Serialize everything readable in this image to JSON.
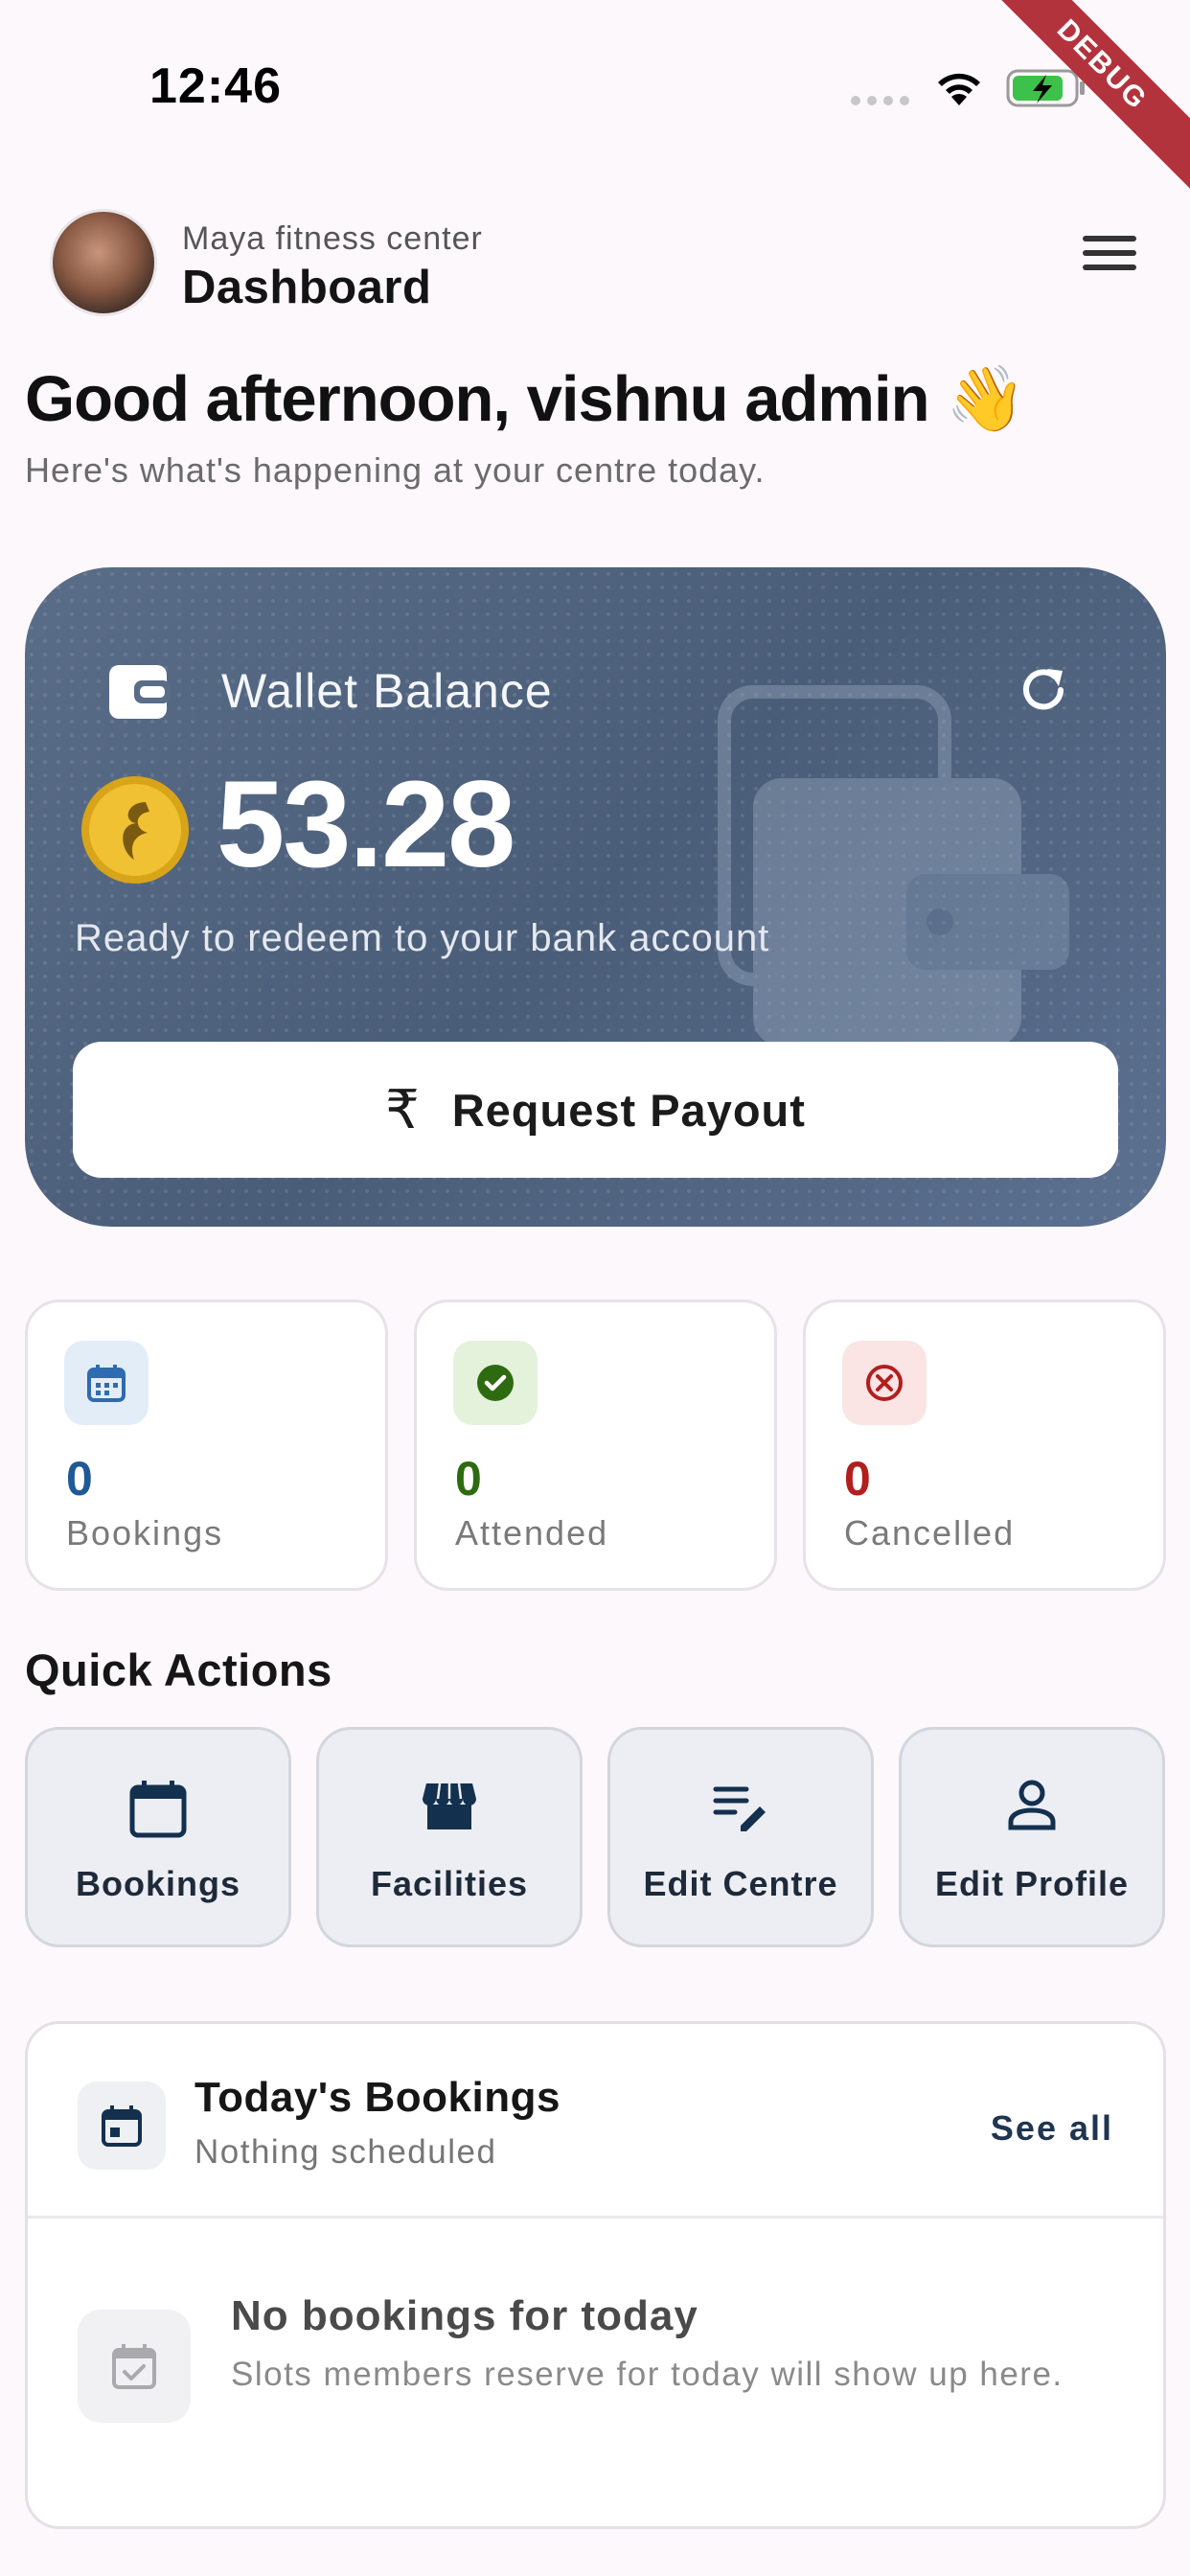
{
  "status_bar": {
    "time": "12:46",
    "debug_label": "DEBUG"
  },
  "header": {
    "centre_name": "Maya fitness center",
    "title": "Dashboard"
  },
  "greeting": {
    "title": "Good afternoon, vishnu admin 👋",
    "subtitle": "Here's what's happening at your centre today."
  },
  "wallet": {
    "label": "Wallet Balance",
    "amount": "53.28",
    "subtitle": "Ready to redeem to your bank account",
    "button_icon": "₹",
    "button_label": "Request Payout"
  },
  "stats": [
    {
      "value": "0",
      "label": "Bookings",
      "color": "#1f5a96",
      "icon_bg": "#e3edf8",
      "icon": "calendar-icon"
    },
    {
      "value": "0",
      "label": "Attended",
      "color": "#2e6b10",
      "icon_bg": "#e4f2dc",
      "icon": "check-circle-icon"
    },
    {
      "value": "0",
      "label": "Cancelled",
      "color": "#b21e1e",
      "icon_bg": "#fbe4e4",
      "icon": "cancel-circle-icon"
    }
  ],
  "quick_actions": {
    "title": "Quick Actions",
    "items": [
      {
        "label": "Bookings",
        "icon": "calendar-icon"
      },
      {
        "label": "Facilities",
        "icon": "storefront-icon"
      },
      {
        "label": "Edit Centre",
        "icon": "edit-note-icon"
      },
      {
        "label": "Edit Profile",
        "icon": "person-icon"
      }
    ]
  },
  "todays_bookings": {
    "title": "Today's Bookings",
    "subtitle": "Nothing scheduled",
    "see_all": "See all",
    "empty_title": "No bookings for today",
    "empty_subtitle": "Slots members reserve for today will show up here."
  }
}
